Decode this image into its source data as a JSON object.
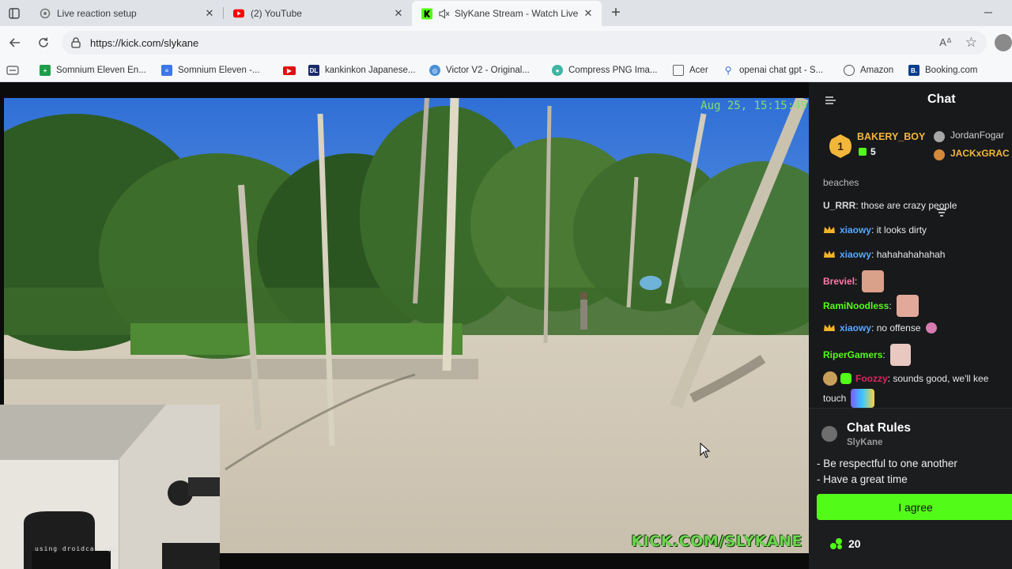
{
  "tabs": [
    {
      "title": "Live reaction setup",
      "favicon": "gear-icon"
    },
    {
      "title": "(2) YouTube",
      "favicon": "youtube-icon"
    },
    {
      "title": "SlyKane Stream - Watch Live",
      "favicon": "kick-icon",
      "muted": true
    }
  ],
  "address": {
    "url": "https://kick.com/slykane"
  },
  "bookmarks": [
    {
      "label": "Somnium Eleven En...",
      "icon": "green-doc-icon"
    },
    {
      "label": "Somnium Eleven -...",
      "icon": "blue-doc-icon"
    },
    {
      "label": "",
      "icon": "youtube-icon"
    },
    {
      "label": "kankinkon Japanese...",
      "icon": "dl-icon"
    },
    {
      "label": "Victor V2 - Original...",
      "icon": "globe-icon"
    },
    {
      "label": "Compress PNG Ima...",
      "icon": "panda-icon"
    },
    {
      "label": "Acer",
      "icon": "folder-icon"
    },
    {
      "label": "openai chat gpt - S...",
      "icon": "search-icon"
    },
    {
      "label": "Amazon",
      "icon": "globe-icon"
    },
    {
      "label": "Booking.com",
      "icon": "booking-icon"
    }
  ],
  "video": {
    "timestamp": "Aug 25, 15:15:49",
    "watermark": "KICK.COM/SLYKANE",
    "webcam_note": "using droidcam app"
  },
  "chat": {
    "title": "Chat",
    "gifters": [
      {
        "rank": "1",
        "name": "BAKERY_BOY",
        "count": "5"
      },
      {
        "name": "JordanFogar"
      },
      {
        "name": "JACKxGRAC"
      }
    ],
    "messages": [
      {
        "user": "",
        "text": "beaches"
      },
      {
        "user": "U_RRR",
        "text": ": those are crazy people",
        "user_color": "#d8d8d8"
      },
      {
        "user": "xiaowy",
        "text": ": it looks dirty",
        "user_color": "#5aa7ff",
        "crown": true
      },
      {
        "user": "xiaowy",
        "text": ": hahahahahahah",
        "user_color": "#5aa7ff",
        "crown": true
      },
      {
        "user": "Breviel",
        "text": ":",
        "user_color": "#ff7aa8"
      },
      {
        "user": "RamiNoodless",
        "text": ":",
        "user_color": "#53fc18"
      },
      {
        "user": "xiaowy",
        "text": ": no offense",
        "user_color": "#5aa7ff",
        "crown": true
      },
      {
        "user": "RiperGamers",
        "text": ":",
        "user_color": "#53fc18"
      },
      {
        "user": "Foozzy",
        "text": ": sounds good, we'll kee",
        "user_color": "#e0245e"
      },
      {
        "user": "",
        "text": "touch"
      }
    ],
    "rules": {
      "title": "Chat Rules",
      "author": "SlyKane",
      "items": [
        "- Be respectful to one another",
        "- Have a great time"
      ],
      "agree_label": "I agree"
    },
    "points": "20"
  },
  "colors": {
    "kick_green": "#53fc18",
    "chat_bg": "#18191b"
  }
}
